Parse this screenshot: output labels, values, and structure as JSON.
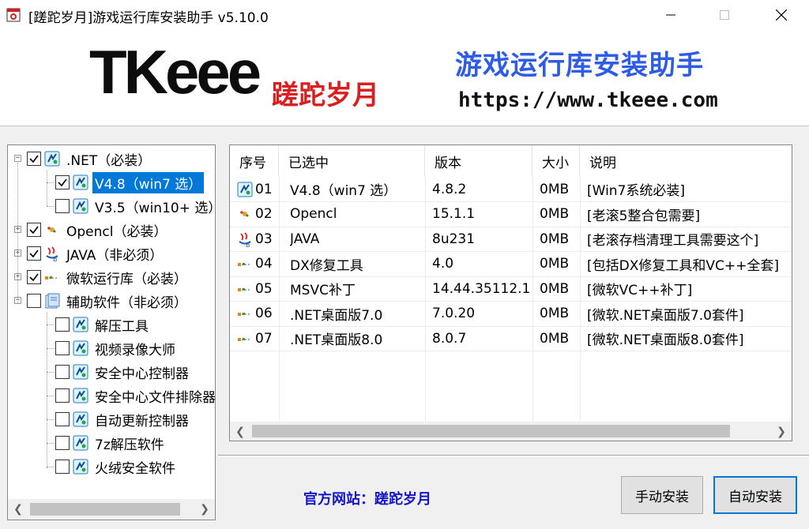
{
  "window": {
    "title": "[蹉跎岁月]游戏运行库安装助手 v5.10.0"
  },
  "banner": {
    "logo_text": "TKeee",
    "logo_cn": "蹉跎岁月",
    "title": "游戏运行库安装助手",
    "url": "https://www.tkeee.com"
  },
  "tree": {
    "nodes": [
      {
        "label": ".NET（必装）",
        "checked": true,
        "level": 0,
        "expanded": true
      },
      {
        "label": "V4.8（win7 选）",
        "checked": true,
        "level": 1,
        "selected": true
      },
      {
        "label": "V3.5（win10+ 选）",
        "checked": false,
        "level": 1
      },
      {
        "label": "Opencl（必装）",
        "checked": true,
        "level": 0,
        "expanded": false
      },
      {
        "label": "JAVA（非必须）",
        "checked": true,
        "level": 0,
        "expanded": false
      },
      {
        "label": "微软运行库（必装）",
        "checked": true,
        "level": 0,
        "expanded": false
      },
      {
        "label": "辅助软件（非必须）",
        "checked": false,
        "level": 0,
        "expanded": true
      },
      {
        "label": "解压工具",
        "checked": false,
        "level": 1
      },
      {
        "label": "视频录像大师",
        "checked": false,
        "level": 1
      },
      {
        "label": "安全中心控制器",
        "checked": false,
        "level": 1
      },
      {
        "label": "安全中心文件排除器",
        "checked": false,
        "level": 1
      },
      {
        "label": "自动更新控制器",
        "checked": false,
        "level": 1
      },
      {
        "label": "7z解压软件",
        "checked": false,
        "level": 1
      },
      {
        "label": "火绒安全软件",
        "checked": false,
        "level": 1
      }
    ]
  },
  "list": {
    "columns": [
      "序号",
      "已选中",
      "版本",
      "大小",
      "说明"
    ],
    "rows": [
      {
        "no": "01",
        "name": "V4.8（win7 选）",
        "version": "4.8.2",
        "size": "0MB",
        "desc": "[Win7系统必装]",
        "icon": "dotnet-icon"
      },
      {
        "no": "02",
        "name": "Opencl",
        "version": "15.1.1",
        "size": "0MB",
        "desc": "[老滚5整合包需要]",
        "icon": "opencl-icon"
      },
      {
        "no": "03",
        "name": "JAVA",
        "version": "8u231",
        "size": "0MB",
        "desc": "[老滚存档清理工具需要这个]",
        "icon": "java-icon"
      },
      {
        "no": "04",
        "name": "DX修复工具",
        "version": "4.0",
        "size": "0MB",
        "desc": "[包括DX修复工具和VC++全套]",
        "icon": "runtime-icon"
      },
      {
        "no": "05",
        "name": "MSVC补丁",
        "version": "14.44.35112.1",
        "size": "0MB",
        "desc": "[微软VC++补丁]",
        "icon": "runtime-icon"
      },
      {
        "no": "06",
        "name": ".NET桌面版7.0",
        "version": "7.0.20",
        "size": "0MB",
        "desc": "[微软.NET桌面版7.0套件]",
        "icon": "runtime-icon"
      },
      {
        "no": "07",
        "name": ".NET桌面版8.0",
        "version": "8.0.7",
        "size": "0MB",
        "desc": "[微软.NET桌面版8.0套件]",
        "icon": "runtime-icon"
      }
    ]
  },
  "footer": {
    "official_site": "官方网站：蹉跎岁月",
    "manual_button": "手动安装",
    "auto_button": "自动安装"
  },
  "colors": {
    "selection": "#0078d7",
    "banner_title": "#2e5ce6",
    "logo_cn": "#d91f1f",
    "official_link": "#1414cc"
  }
}
